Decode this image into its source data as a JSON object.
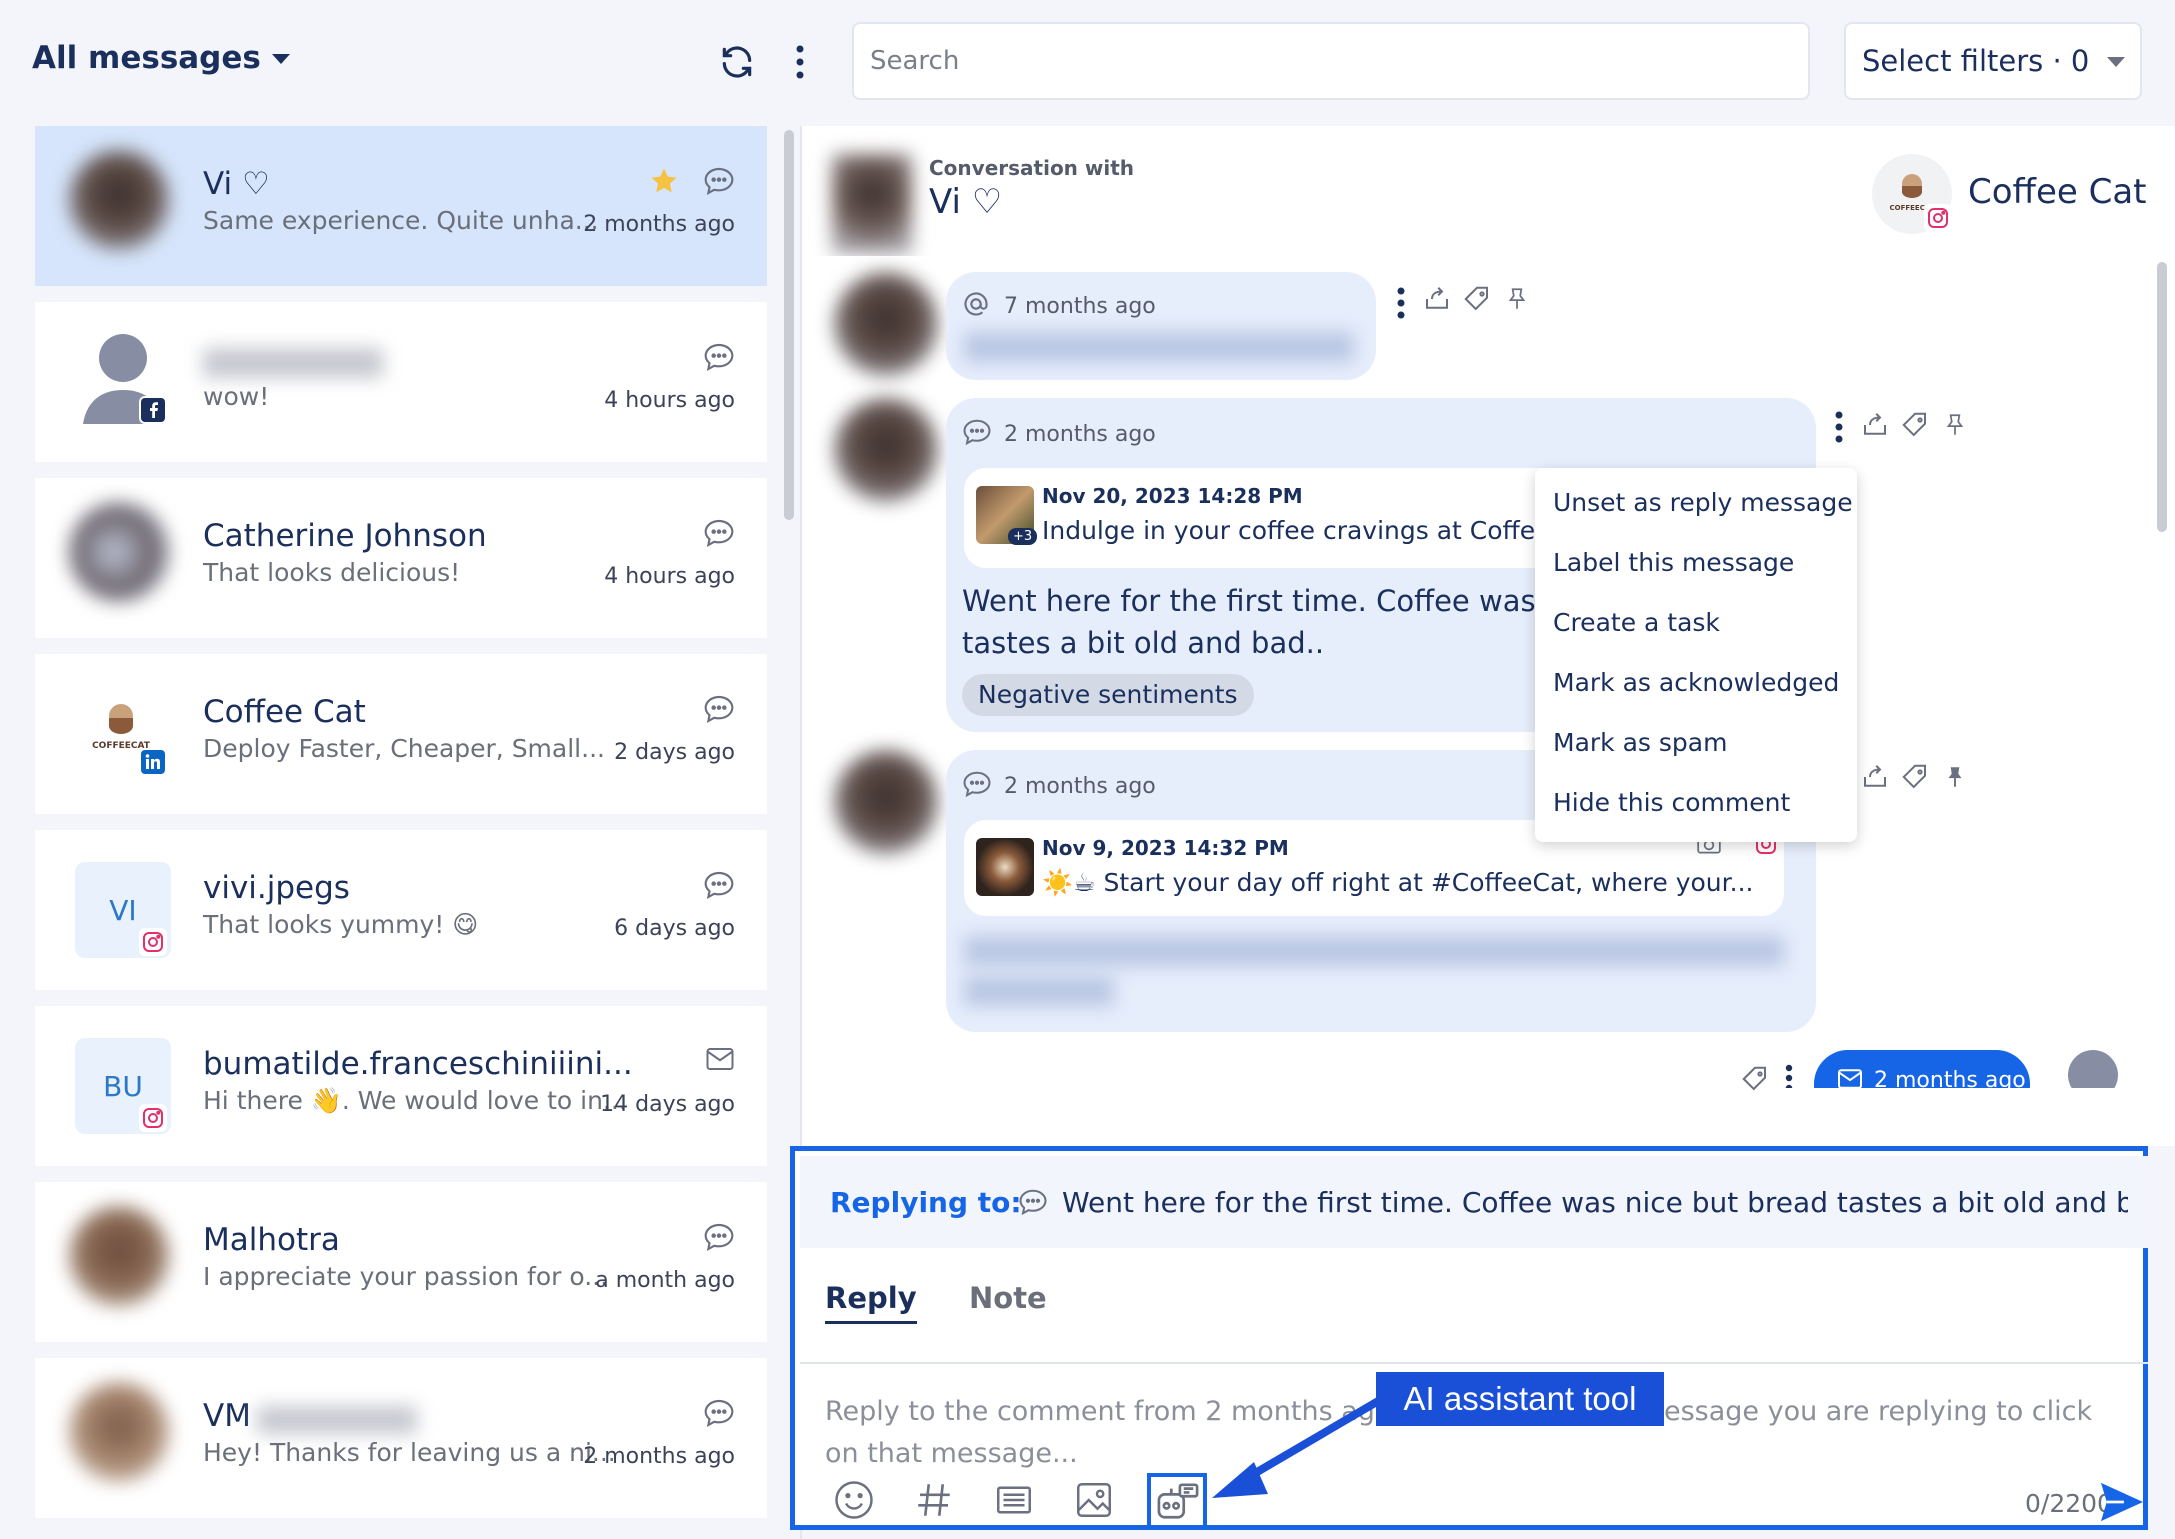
{
  "header": {
    "filter_title": "All messages",
    "search_placeholder": "Search",
    "filters_label": "Select filters · 0"
  },
  "conversations": [
    {
      "name": "Vi ♡",
      "preview": "Same experience. Quite unha...",
      "time": "2 months ago",
      "starred": true,
      "type_icon": "comment-icon"
    },
    {
      "name": "",
      "preview": "wow!",
      "time": "4 hours ago",
      "platform": "facebook",
      "type_icon": "comment-icon"
    },
    {
      "name": "Catherine Johnson",
      "preview": "That looks delicious!",
      "time": "4 hours ago",
      "type_icon": "comment-icon"
    },
    {
      "name": "Coffee Cat",
      "preview": "Deploy Faster, Cheaper, Small...",
      "time": "2 days ago",
      "platform": "linkedin",
      "type_icon": "comment-icon"
    },
    {
      "name": "vivi.jpegs",
      "preview": "That looks yummy! 😋",
      "time": "6 days ago",
      "initials": "VI",
      "platform": "instagram",
      "type_icon": "comment-icon"
    },
    {
      "name": "bumatilde.franceschiniiini...",
      "preview": "Hi there 👋. We would love to in...",
      "time": "14 days ago",
      "initials": "BU",
      "platform": "instagram",
      "type_icon": "mail-icon"
    },
    {
      "name": "Malhotra",
      "preview": "I appreciate your passion for o...",
      "time": "a month ago",
      "type_icon": "comment-icon"
    },
    {
      "name": "VM",
      "preview": "Hey! Thanks for leaving us a ni...",
      "time": "2 months ago",
      "type_icon": "comment-icon"
    }
  ],
  "conversation": {
    "subtitle": "Conversation with",
    "name": "Vi ♡",
    "brand": "Coffee Cat",
    "brand_logo_text": "COFFEECAT"
  },
  "messages": [
    {
      "time": "7 months ago",
      "icon": "mention-icon"
    },
    {
      "time": "2 months ago",
      "post_date": "Nov 20, 2023 14:28 PM",
      "post_text": "Indulge in your coffee cravings at Coffee",
      "post_more": "+3",
      "body_line1": "Went here for the first time. Coffee was ni",
      "body_line2": "tastes a bit old and bad..",
      "tag": "Negative sentiments"
    },
    {
      "time": "2 months ago",
      "post_date": "Nov 9, 2023 14:32 PM",
      "post_text": "☀️☕ Start your day off right at #CoffeeCat, where your..."
    },
    {
      "time": "2 months ago"
    }
  ],
  "context_menu": [
    "Unset as reply message",
    "Label this message",
    "Create a task",
    "Mark as acknowledged",
    "Mark as spam",
    "Hide this comment"
  ],
  "reply": {
    "replying_label": "Replying to:",
    "replying_text": "Went here for the first time. Coffee was nice but bread tastes a bit old and b...",
    "tab_reply": "Reply",
    "tab_note": "Note",
    "placeholder": "Reply to the comment from 2 months ago. To reply to other message you are replying to click on that message...",
    "counter": "0/2200"
  },
  "annotation": {
    "label": "AI assistant tool",
    "color": "#1a4fd8"
  },
  "colors": {
    "accent": "#1565e6",
    "navy": "#1a2f5c",
    "selected_card": "#d6e5fb",
    "bubble": "#e6eefc",
    "star": "#f5c242",
    "instagram": "#e1306c",
    "facebook": "#1877f2",
    "linkedin": "#0a66c2"
  }
}
